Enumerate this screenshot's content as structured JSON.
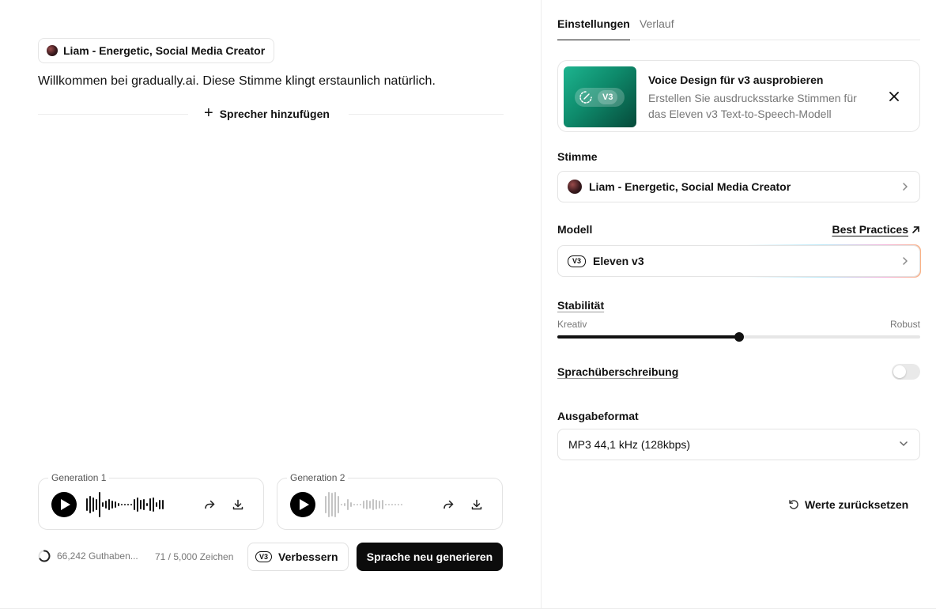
{
  "editor": {
    "speaker_name": "Liam - Energetic, Social Media Creator",
    "text": "Willkommen bei gradually.ai. Diese Stimme klingt erstaunlich natürlich.",
    "add_speaker_label": "Sprecher hinzufügen"
  },
  "generations": [
    {
      "label": "Generation 1",
      "active": true
    },
    {
      "label": "Generation 2",
      "active": false
    }
  ],
  "footer": {
    "credits": "66,242 Guthaben...",
    "char_count": "71 / 5,000 Zeichen",
    "enhance_badge": "V3",
    "enhance_label": "Verbessern",
    "generate_label": "Sprache neu generieren"
  },
  "settings": {
    "tabs": [
      {
        "label": "Einstellungen",
        "active": true
      },
      {
        "label": "Verlauf",
        "active": false
      }
    ],
    "promo": {
      "badge": "V3",
      "title": "Voice Design für v3 ausprobieren",
      "description": "Erstellen Sie ausdrucksstarke Stimmen für das Eleven v3 Text-to-Speech-Modell"
    },
    "voice": {
      "label": "Stimme",
      "value": "Liam - Energetic, Social Media Creator"
    },
    "model": {
      "label": "Modell",
      "best_practices": "Best Practices",
      "badge": "V3",
      "value": "Eleven v3"
    },
    "stability": {
      "label": "Stabilität",
      "min_label": "Kreativ",
      "max_label": "Robust",
      "value": 0.5
    },
    "language_override": {
      "label": "Sprachüberschreibung",
      "enabled": false
    },
    "output_format": {
      "label": "Ausgabeformat",
      "value": "MP3 44,1 kHz (128kbps)"
    },
    "reset_label": "Werte zurücksetzen"
  },
  "colors": {
    "accent": "#0c0c0c",
    "promo_green": "#0e8a6b",
    "muted_text": "#777777"
  }
}
